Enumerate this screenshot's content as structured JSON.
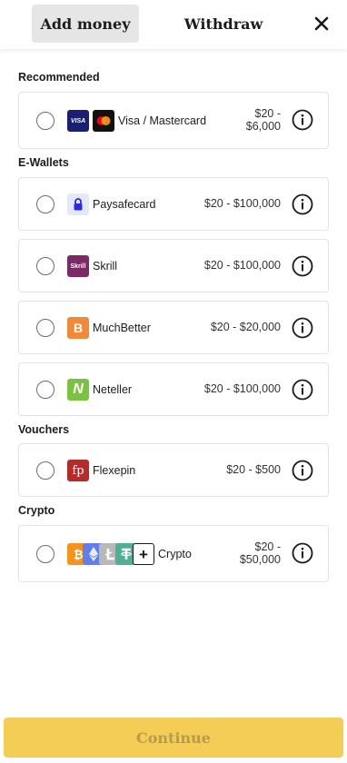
{
  "tabs": {
    "add_money": "Add money",
    "withdraw": "Withdraw"
  },
  "sections": {
    "recommended": "Recommended",
    "ewallets": "E-Wallets",
    "vouchers": "Vouchers",
    "crypto": "Crypto"
  },
  "methods": [
    {
      "name": "Visa / Mastercard",
      "range_line1": "$20 -",
      "range_line2": "$6,000",
      "visa_text": "VISA"
    },
    {
      "name": "Paysafecard",
      "range": "$20 - $100,000"
    },
    {
      "name": "Skrill",
      "range": "$20 - $100,000",
      "logo_text": "Skrill"
    },
    {
      "name": "MuchBetter",
      "range": "$20 - $20,000",
      "logo_text": "B"
    },
    {
      "name": "Neteller",
      "range": "$20 - $100,000",
      "logo_text": "N"
    },
    {
      "name": "Flexepin",
      "range": "$20 - $500",
      "logo_text": "fp"
    },
    {
      "name": "Crypto",
      "range_line1": "$20 -",
      "range_line2": "$50,000",
      "logo_text": "+"
    }
  ],
  "continue_label": "Continue",
  "colors": {
    "accent": "#f3cd55",
    "visa_bg": "#1a1f71",
    "paysafe_bg": "#e4e8fb",
    "paysafe_lock": "#2b2bd9",
    "skrill_bg": "#7b2a66",
    "muchbetter_bg": "#f0893a",
    "neteller_bg": "#7cc242",
    "flexepin_bg": "#b42b2b",
    "bitcoin": "#f7931a",
    "ethereum": "#627eea",
    "litecoin": "#b8b8b8",
    "tether": "#50af95"
  }
}
